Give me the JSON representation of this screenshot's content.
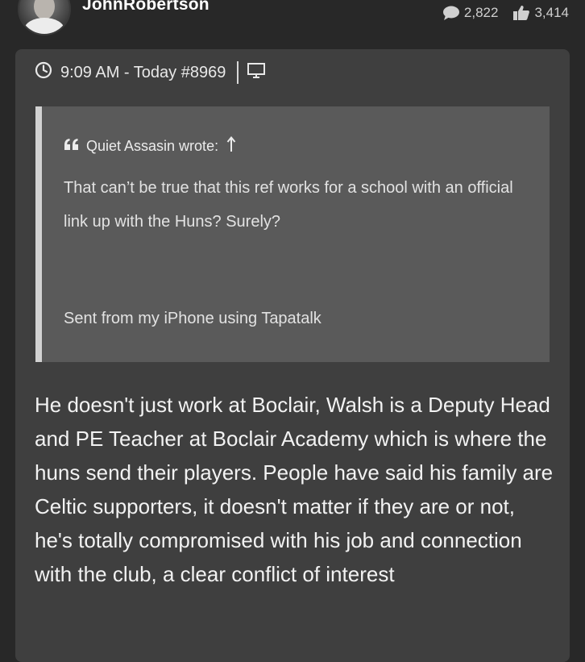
{
  "author": {
    "username": "JohnRobertson",
    "avatar_icon": "user-avatar",
    "stats": {
      "posts_icon": "speech-bubble-icon",
      "posts": "2,822",
      "likes_icon": "thumbs-up-icon",
      "likes": "3,414"
    }
  },
  "post": {
    "meta": {
      "time_icon": "clock-icon",
      "timestamp": "9:09 AM - Today #8969",
      "device_icon": "monitor-icon"
    },
    "quote": {
      "quote_icon": "quote-mark-icon",
      "author_line": "Quiet Assasin wrote:",
      "jump_icon": "up-arrow-icon",
      "text": "That can’t be true that this ref works for a school with an official link up with the Huns? Surely?",
      "signature": "Sent from my iPhone using Tapatalk"
    },
    "body": "He doesn't just work at Boclair, Walsh is a Deputy Head and PE Teacher at Boclair Academy which is where the huns send their players. People have said his family are Celtic supporters, it doesn't matter if they are or not, he's totally compromised with his job and connection with the club, a clear conflict of interest"
  },
  "colors": {
    "page_bg": "#282828",
    "card_bg": "#3f3f3f",
    "quote_bg": "#5a5a5a",
    "quote_border": "#d2d2d2",
    "text": "#f2f2f2"
  }
}
